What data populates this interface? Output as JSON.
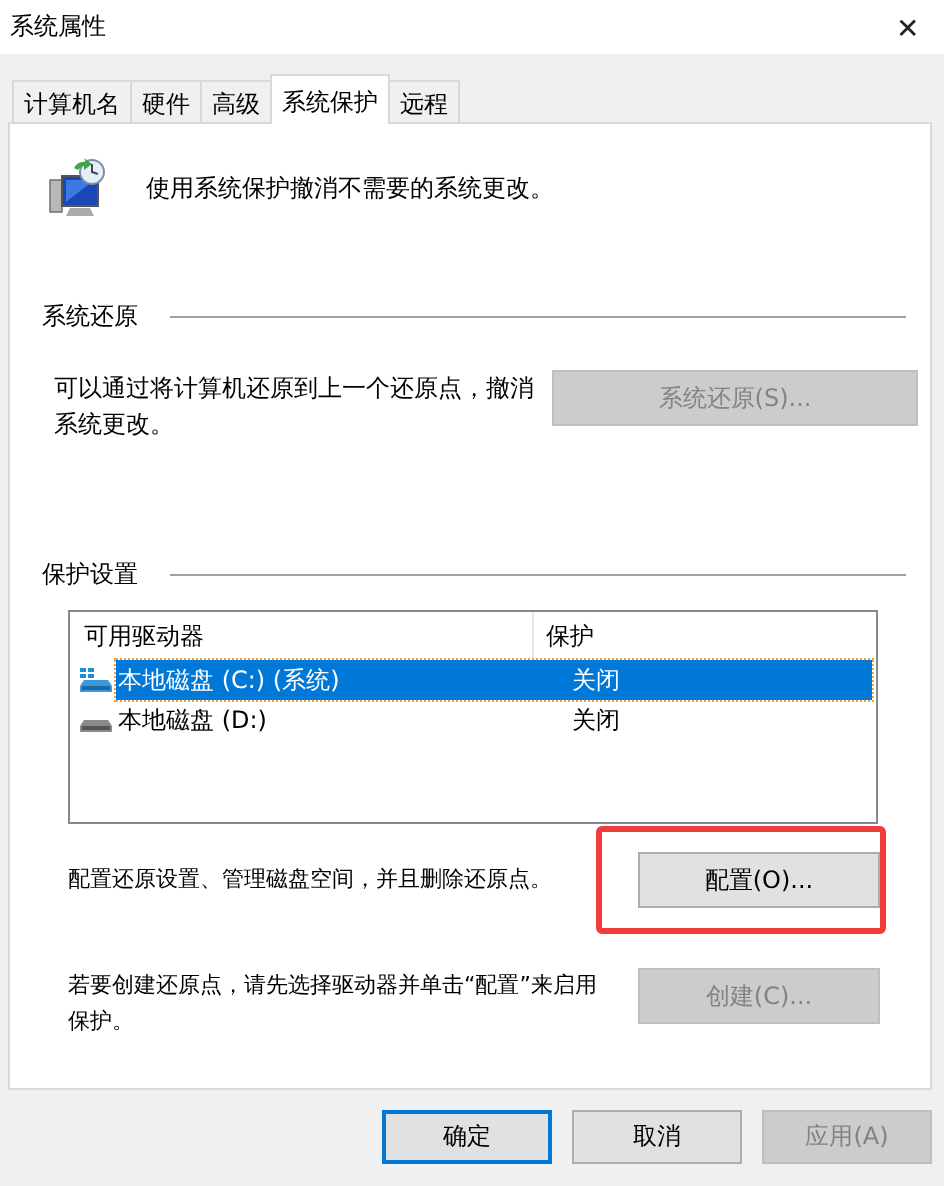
{
  "window": {
    "title": "系统属性",
    "close": "✕"
  },
  "tabs": [
    {
      "label": "计算机名",
      "selected": false
    },
    {
      "label": "硬件",
      "selected": false
    },
    {
      "label": "高级",
      "selected": false
    },
    {
      "label": "系统保护",
      "selected": true
    },
    {
      "label": "远程",
      "selected": false
    }
  ],
  "intro": "使用系统保护撤消不需要的系统更改。",
  "restore": {
    "heading": "系统还原",
    "text": "可以通过将计算机还原到上一个还原点，撤消系统更改。",
    "button": {
      "label": "系统还原(S)...",
      "disabled": true
    }
  },
  "protection": {
    "heading": "保护设置",
    "columns": [
      "可用驱动器",
      "保护"
    ],
    "rows": [
      {
        "drive": "本地磁盘 (C:) (系统)",
        "status": "关闭",
        "system": true,
        "selected": true
      },
      {
        "drive": "本地磁盘 (D:)",
        "status": "关闭",
        "system": false,
        "selected": false
      }
    ],
    "configure": {
      "text": "配置还原设置、管理磁盘空间，并且删除还原点。",
      "button": {
        "label": "配置(O)...",
        "disabled": false,
        "highlighted": true
      }
    },
    "create": {
      "text": "若要创建还原点，请先选择驱动器并单击“配置”来启用保护。",
      "button": {
        "label": "创建(C)...",
        "disabled": true
      }
    }
  },
  "buttons": [
    {
      "label": "确定",
      "disabled": false,
      "default": true
    },
    {
      "label": "取消",
      "disabled": false,
      "default": false
    },
    {
      "label": "应用(A)",
      "disabled": true,
      "default": false
    }
  ]
}
